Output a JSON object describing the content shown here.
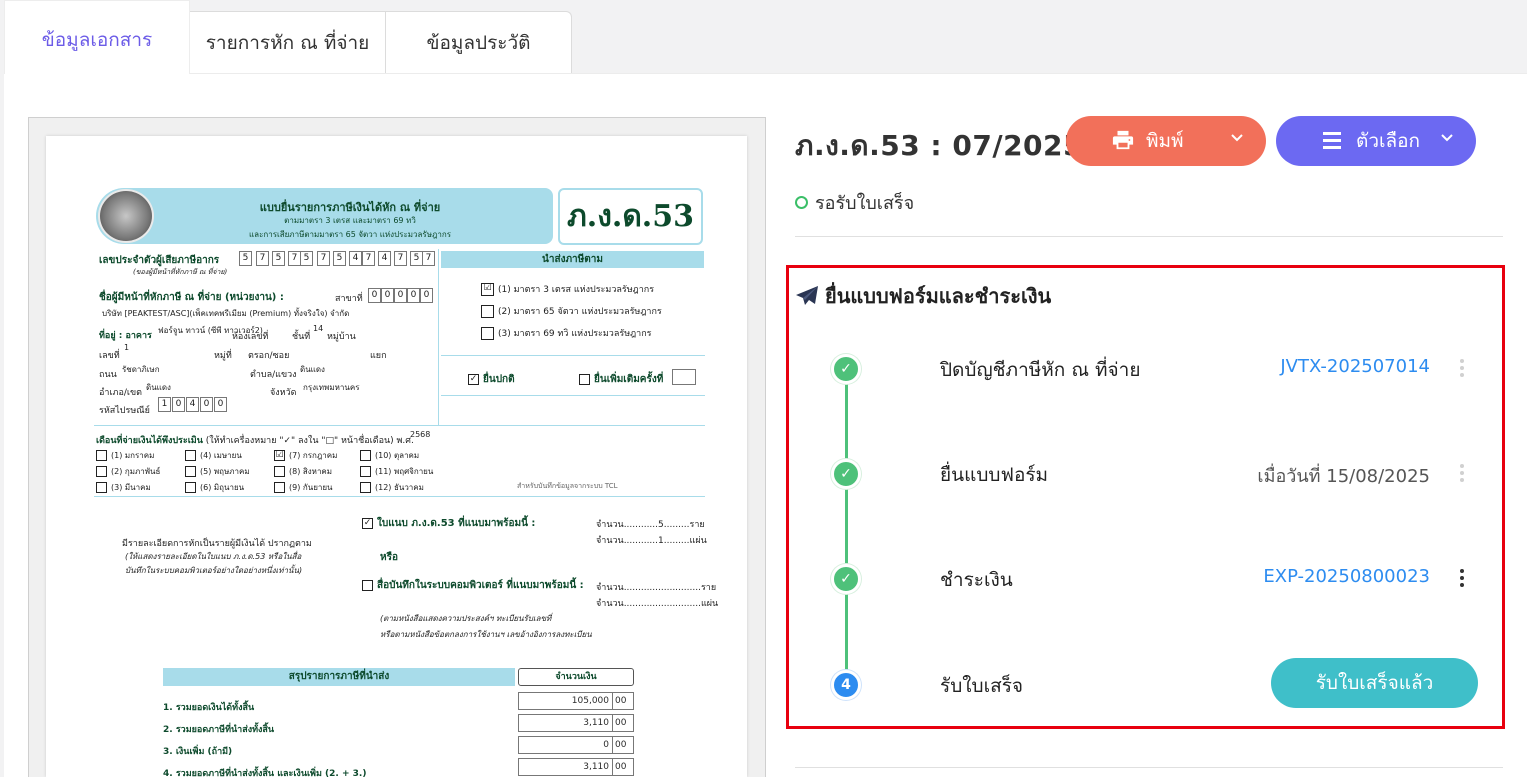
{
  "tabs": [
    {
      "label": "ข้อมูลเอกสาร",
      "active": true
    },
    {
      "label": "รายการหัก ณ ที่จ่าย",
      "active": false
    },
    {
      "label": "ข้อมูลประวัติ",
      "active": false
    }
  ],
  "form": {
    "band_title": "แบบยื่นรายการภาษีเงินได้หัก ณ ที่จ่าย",
    "band_sub1": "ตามมาตรา 3 เตรส และมาตรา 69 ทวิ",
    "band_sub2": "และการเสียภาษีตามมาตรา 65 จัตวา แห่งประมวลรัษฎากร",
    "form_code": "ภ.ง.ด.53",
    "taxid_label": "เลขประจำตัวผู้เสียภาษีอากร",
    "taxid_sublabel": "(ของผู้มีหน้าที่หักภาษี ณ ที่จ่าย)",
    "taxid_digits": [
      "5",
      "7",
      "5",
      "7",
      "5",
      "7",
      "5",
      "4",
      "7",
      "4",
      "7",
      "5",
      "7"
    ],
    "submit_header": "นำส่งภาษีตาม",
    "submit_options": [
      {
        "mark": "☑",
        "text": "(1) มาตรา 3 เตรส แห่งประมวลรัษฎากร"
      },
      {
        "mark": "",
        "text": "(2) มาตรา 65 จัตวา แห่งประมวลรัษฎากร"
      },
      {
        "mark": "",
        "text": "(3) มาตรา 69 ทวิ แห่งประมวลรัษฎากร"
      }
    ],
    "payer_label": "ชื่อผู้มีหน้าที่หักภาษี ณ ที่จ่าย (หน่วยงาน) :",
    "branch_label": "สาขาที่",
    "branch_digits": [
      "0",
      "0",
      "0",
      "0",
      "0"
    ],
    "company_name": "บริษัท [PEAKTEST/ASC](เพ็คเทคพรีเมียม (Premium) ทั้งจริงใจ) จำกัด",
    "address_label": "ที่อยู่ : อาคาร",
    "building": "ฟอร์จูน ทาวน์ (ซีพี ทาวเวอร์2)",
    "room_label": "ห้องเลขที่",
    "floor_label": "ชั้นที่",
    "floor": "14",
    "village_label": "หมู่บ้าน",
    "house_no_label": "เลขที่",
    "house_no": "1",
    "moo_label": "หมู่ที่",
    "soi_label": "ตรอก/ซอย",
    "yaek_label": "แยก",
    "road_label": "ถนน",
    "road": "รัชดาภิเษก",
    "subdistrict_label": "ตำบล/แขวง",
    "subdistrict": "ดินแดง",
    "district_label": "อำเภอ/เขต",
    "district": "ดินแดง",
    "province_label": "จังหวัด",
    "province": "กรุงเทพมหานคร",
    "postcode_label": "รหัสไปรษณีย์",
    "postcode_digits": [
      "1",
      "0",
      "4",
      "0",
      "0"
    ],
    "normal_filing": "ยื่นปกติ",
    "additional_filing": "ยื่นเพิ่มเติมครั้งที่",
    "month_label": "เดือนที่จ่ายเงินได้พึงประเมิน",
    "month_hint": "(ให้ทำเครื่องหมาย \"✓\" ลงใน \"□\" หน้าชื่อเดือน) พ.ศ.",
    "year": "2568",
    "months": [
      {
        "mark": "",
        "text": "(1) มกราคม"
      },
      {
        "mark": "",
        "text": "(4) เมษายน"
      },
      {
        "mark": "☑",
        "text": "(7) กรกฎาคม"
      },
      {
        "mark": "",
        "text": "(10) ตุลาคม"
      },
      {
        "mark": "",
        "text": "(2) กุมภาพันธ์"
      },
      {
        "mark": "",
        "text": "(5) พฤษภาคม"
      },
      {
        "mark": "",
        "text": "(8) สิงหาคม"
      },
      {
        "mark": "",
        "text": "(11) พฤศจิกายน"
      },
      {
        "mark": "",
        "text": "(3) มีนาคม"
      },
      {
        "mark": "",
        "text": "(6) มิถุนายน"
      },
      {
        "mark": "",
        "text": "(9) กันยายน"
      },
      {
        "mark": "",
        "text": "(12) ธันวาคม"
      }
    ],
    "tcl_note": "สำหรับบันทึกข้อมูลจากระบบ TCL",
    "detail_text": "มีรายละเอียดการหักเป็นรายผู้มีเงินได้ ปรากฏตาม",
    "detail_hint1": "(ให้แสดงรายละเอียดในใบแนบ ภ.ง.ด.53 หรือในสื่อ",
    "detail_hint2": "บันทึกในระบบคอมพิวเตอร์อย่างใดอย่างหนึ่งเท่านั้น)",
    "attach_label": "ใบแนบ ภ.ง.ด.53 ที่แนบมาพร้อมนี้ :",
    "count_label": "จำนวน",
    "count_value_1": "5",
    "unit_persons": "ราย",
    "count_value_2": "1",
    "unit_sheets": "แผ่น",
    "or_label": "หรือ",
    "media_label": "สื่อบันทึกในระบบคอมพิวเตอร์ ที่แนบมาพร้อมนี้ :",
    "media_hint1": "(ตามหนังสือแสดงความประสงค์ฯ ทะเบียนรับเลขที่",
    "media_hint2": "หรือตามหนังสือข้อตกลงการใช้งานฯ เลขอ้างอิงการลงทะเบียน",
    "summary_header": "สรุปรายการภาษีที่นำส่ง",
    "amount_header": "จำนวนเงิน",
    "summary_rows": [
      {
        "label": "1. รวมยอดเงินได้ทั้งสิ้น",
        "amount": "105,000",
        "satang": "00"
      },
      {
        "label": "2. รวมยอดภาษีที่นำส่งทั้งสิ้น",
        "amount": "3,110",
        "satang": "00"
      },
      {
        "label": "3. เงินเพิ่ม (ถ้ามี)",
        "amount": "0",
        "satang": "00"
      },
      {
        "label": "4. รวมยอดภาษีที่นำส่งทั้งสิ้น และเงินเพิ่ม (2. + 3.)",
        "amount": "3,110",
        "satang": "00"
      }
    ]
  },
  "header": {
    "title": "ภ.ง.ด.53 : 07/2025",
    "print_label": "พิมพ์",
    "options_label": "ตัวเลือก",
    "status": "รอรับใบเสร็จ"
  },
  "flow": {
    "title": "ยื่นแบบฟอร์มและชำระเงิน",
    "steps": [
      {
        "label": "ปิดบัญชีภาษีหัก ณ ที่จ่าย",
        "value": "JVTX-202507014",
        "state": "done"
      },
      {
        "label": "ยื่นแบบฟอร์ม",
        "value": "เมื่อวันที่ 15/08/2025",
        "state": "done"
      },
      {
        "label": "ชำระเงิน",
        "value": "EXP-20250800023",
        "state": "done"
      },
      {
        "label": "รับใบเสร็จ",
        "value": "",
        "state": "current",
        "number": "4"
      }
    ],
    "receipt_button": "รับใบเสร็จแล้ว"
  },
  "colors": {
    "accent": "#6c5ce7",
    "print": "#f2705a",
    "options": "#6c69f2",
    "success": "#4ec17a",
    "link": "#2d8cf0",
    "receipt": "#3fbfc9",
    "highlight": "#e8000e"
  }
}
